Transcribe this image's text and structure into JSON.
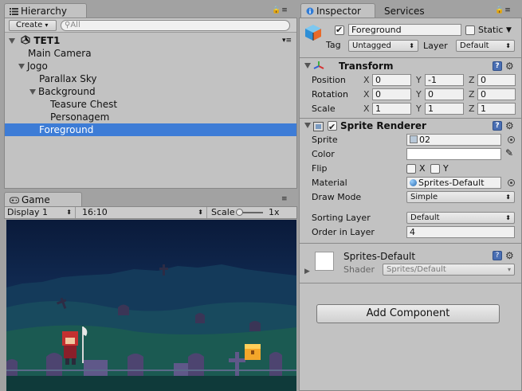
{
  "hierarchy": {
    "tab_label": "Hierarchy",
    "create_label": "Create",
    "search_placeholder": "All",
    "scene_name": "TET1",
    "items": [
      {
        "label": "Main Camera"
      },
      {
        "label": "Jogo"
      },
      {
        "label": "Parallax Sky"
      },
      {
        "label": "Background"
      },
      {
        "label": "Teasure Chest"
      },
      {
        "label": "Personagem"
      },
      {
        "label": "Foreground"
      }
    ]
  },
  "game": {
    "tab_label": "Game",
    "display": "Display 1",
    "aspect": "16:10",
    "scale_label": "Scale",
    "scale_value": "1x"
  },
  "inspector": {
    "tab_label": "Inspector",
    "services_tab_label": "Services",
    "object_name": "Foreground",
    "static_label": "Static",
    "tag_label": "Tag",
    "tag_value": "Untagged",
    "layer_label": "Layer",
    "layer_value": "Default",
    "transform": {
      "title": "Transform",
      "position_label": "Position",
      "rotation_label": "Rotation",
      "scale_label": "Scale",
      "axis_x": "X",
      "axis_y": "Y",
      "axis_z": "Z",
      "position": {
        "x": "0",
        "y": "-1",
        "z": "0"
      },
      "rotation": {
        "x": "0",
        "y": "0",
        "z": "0"
      },
      "scale": {
        "x": "1",
        "y": "1",
        "z": "1"
      }
    },
    "sprite_renderer": {
      "title": "Sprite Renderer",
      "sprite_label": "Sprite",
      "sprite_value": "02",
      "color_label": "Color",
      "flip_label": "Flip",
      "flip_x": "X",
      "flip_y": "Y",
      "material_label": "Material",
      "material_value": "Sprites-Default",
      "draw_mode_label": "Draw Mode",
      "draw_mode_value": "Simple",
      "sorting_layer_label": "Sorting Layer",
      "sorting_layer_value": "Default",
      "order_in_layer_label": "Order in Layer",
      "order_in_layer_value": "4"
    },
    "material": {
      "name": "Sprites-Default",
      "shader_label": "Shader",
      "shader_value": "Sprites/Default"
    },
    "add_component_label": "Add Component"
  },
  "colors": {
    "selection": "#3d7cd6",
    "panel_bg": "#c2c2c2",
    "night_sky": "#0e2144",
    "grass": "#1b5a52"
  }
}
